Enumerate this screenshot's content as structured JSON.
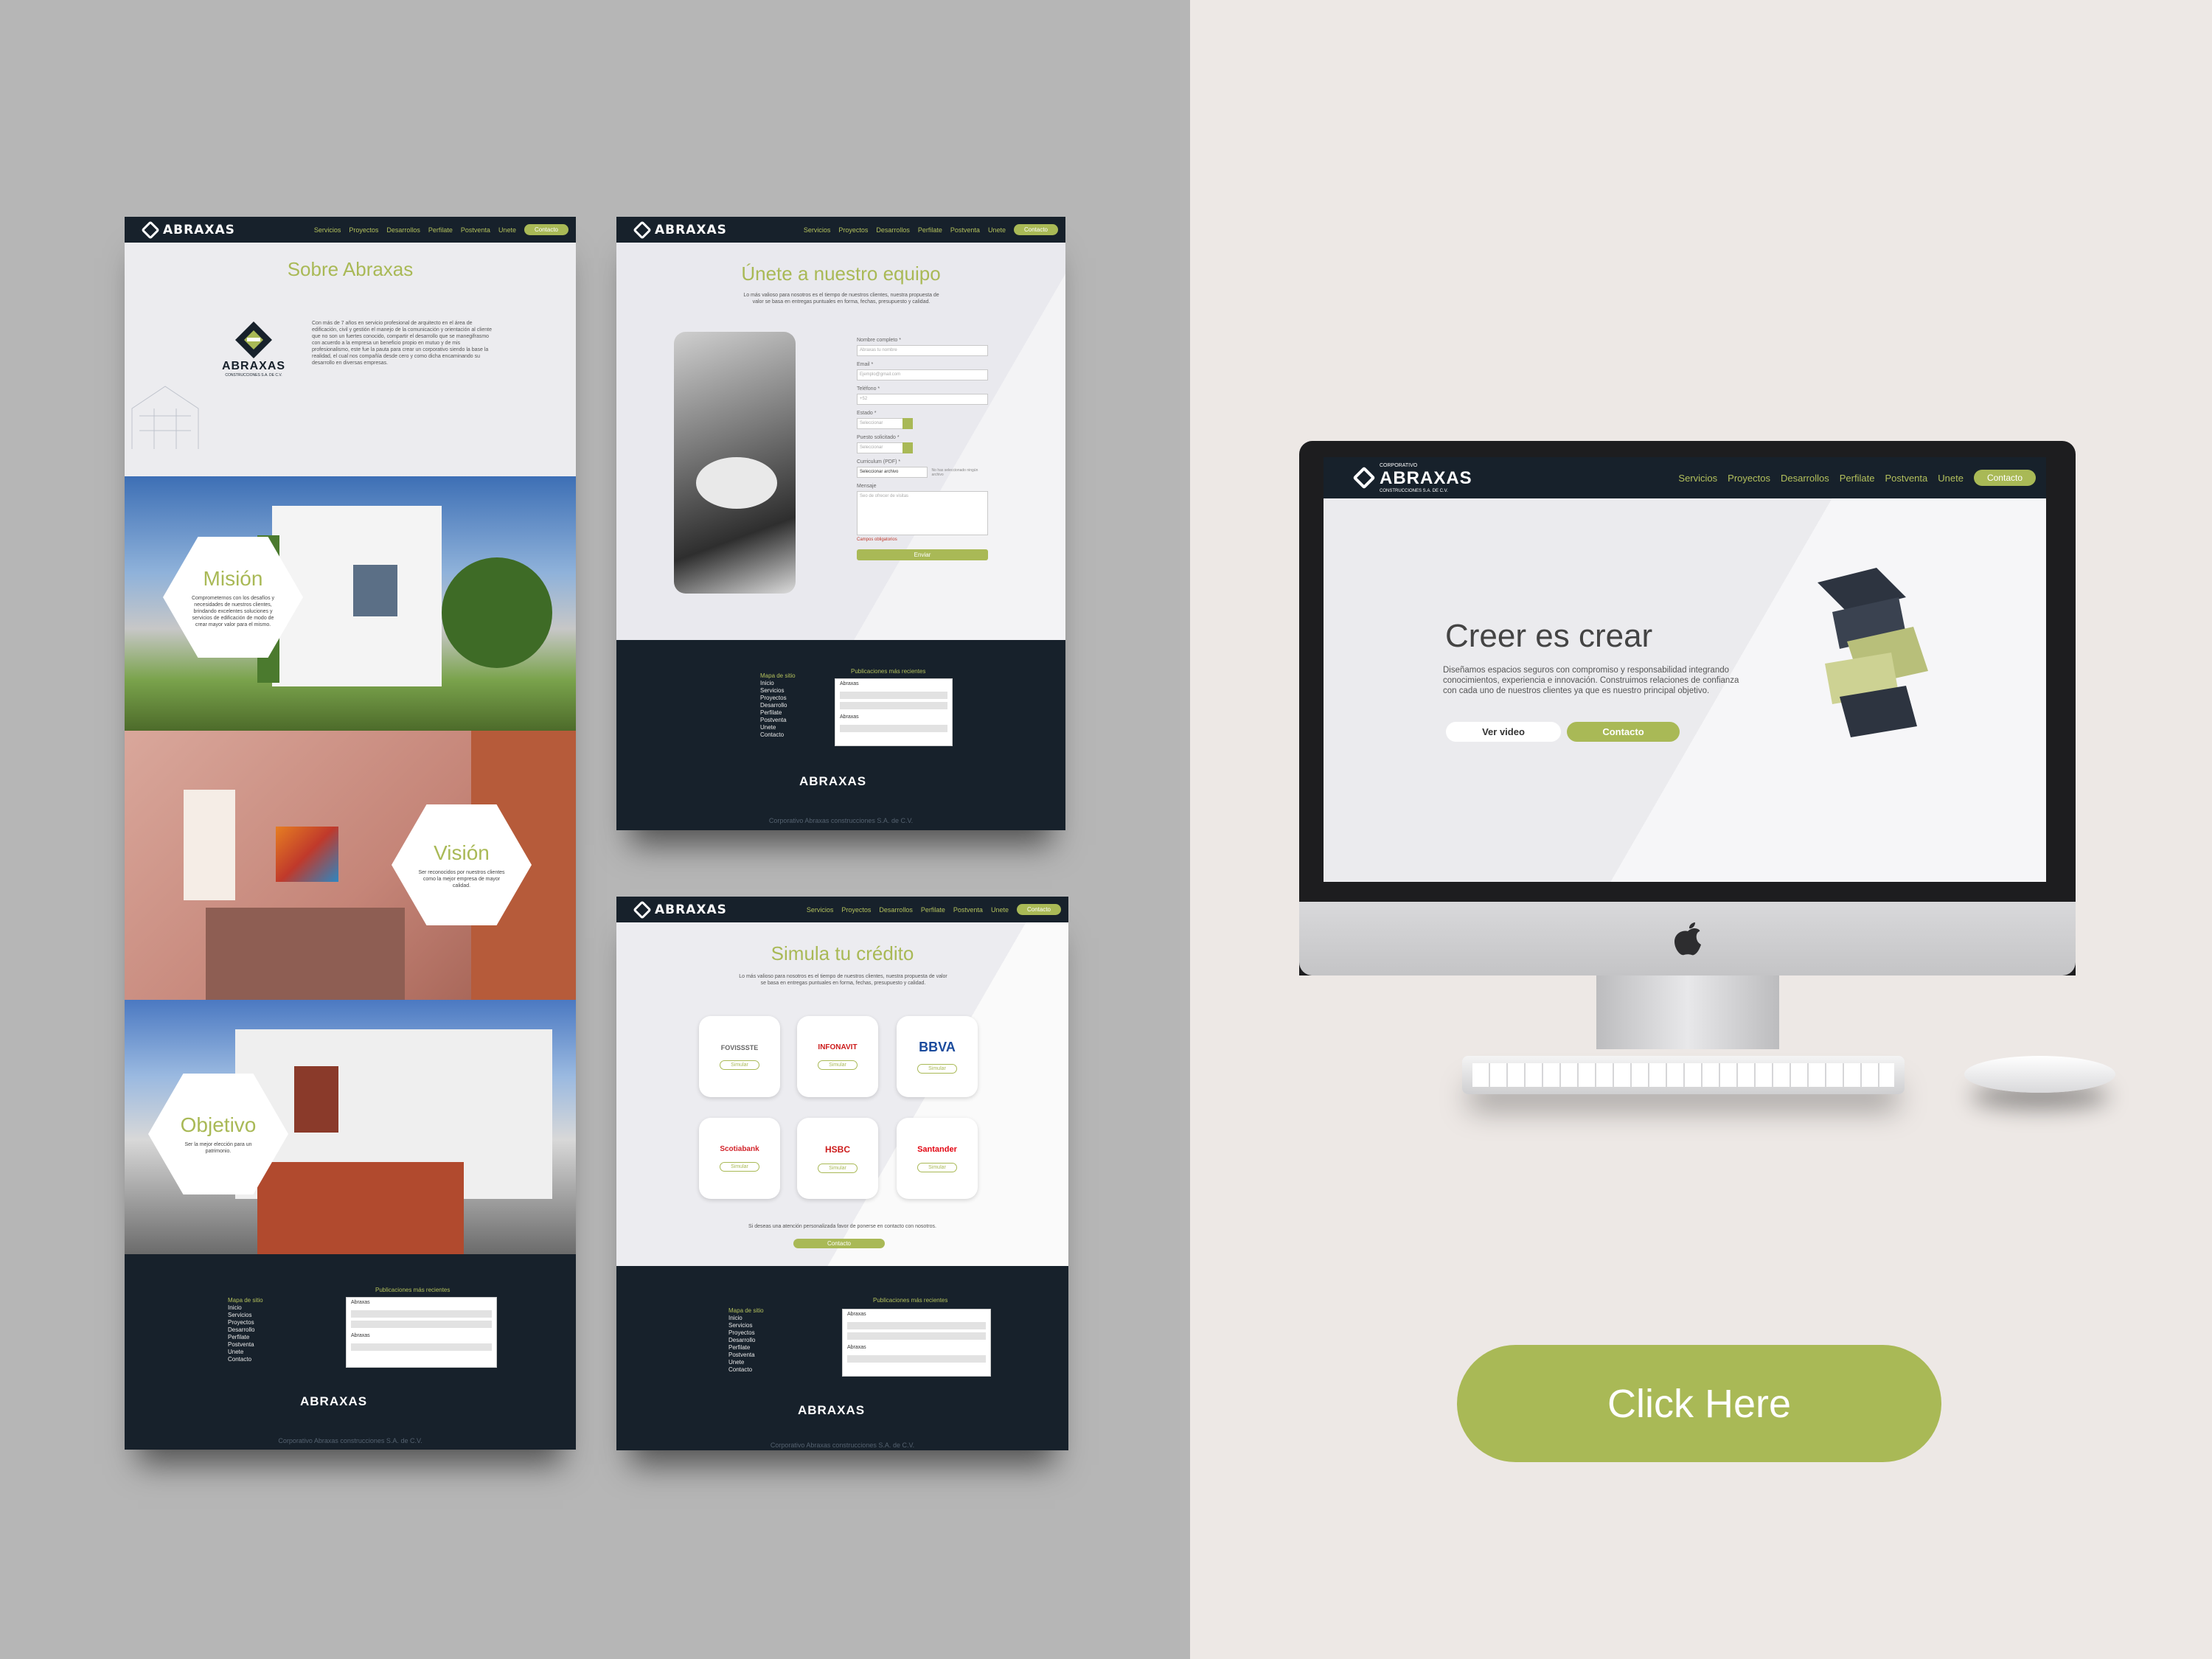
{
  "brand": {
    "name": "ABRAXAS",
    "corporate": "CORPORATIVO",
    "sub": "CONSTRUCCIONES S.A. DE C.V.",
    "accent": "#a9b956",
    "dark": "#17212b"
  },
  "nav": {
    "links": [
      "Servicios",
      "Proyectos",
      "Desarrollos",
      "Perfilate",
      "Postventa",
      "Unete"
    ],
    "contact": "Contacto"
  },
  "about": {
    "title": "Sobre Abraxas",
    "body": "Con más de 7 años en servicio profesional de arquitecto en el área de edificación, civil y gestión el manejo de la comunicación y orientación al cliente que no son un fuertes conocido, compartir el desarrollo que se manegifrasmo con acuerdo a la empresa un beneficio propio en mutuo y de mis profesionalismo, este fue la pauta para crear un corporativo siendo la base la realidad, el cual nos compañía desde cero y como dicha encaminando su desarrollo en diversas empresas."
  },
  "mission": {
    "title": "Misión",
    "text": "Comprometernos con los desafíos y necesidades de nuestros clientes, brindando excelentes soluciones y servicios de edificación de modo de crear mayor valor para el mismo."
  },
  "vision": {
    "title": "Visión",
    "text": "Ser reconocidos por nuestros clientes como la mejor empresa de mayor calidad."
  },
  "objective": {
    "title": "Objetivo",
    "text": "Ser la mejor elección para un patrimonio."
  },
  "join": {
    "title": "Únete a nuestro equipo",
    "intro": "Lo más valioso para nosotros es el tiempo de nuestros clientes, nuestra propuesta de valor se basa en entregas puntuales en forma, fechas, presupuesto y calidad.",
    "fields": [
      {
        "label": "Nombre completo *",
        "placeholder": "Abraxas tu nombre"
      },
      {
        "label": "Email *",
        "placeholder": "Ejemplo@gmail.com"
      },
      {
        "label": "Teléfono *",
        "placeholder": "+52"
      },
      {
        "label": "Estado *",
        "placeholder": "Seleccionar"
      },
      {
        "label": "Puesto solicitado *",
        "placeholder": "Seleccionar"
      },
      {
        "label": "Curriculum (PDF) *",
        "placeholder": "Seleccionar archivo"
      }
    ],
    "file_note": "No has seleccionado ningún archivo",
    "message_label": "Mensaje",
    "message_placeholder": "Seo de ofrecer de visitas",
    "required_note": "Campos obligatorios",
    "submit": "Enviar"
  },
  "footer": {
    "sitemap_title": "Mapa de sitio",
    "sitemap": [
      "Inicio",
      "Servicios",
      "Proyectos",
      "Desarrollo",
      "Perfilate",
      "Postventa",
      "Unete",
      "Contacto"
    ],
    "publications_title": "Publicaciones más recientes",
    "feed_names": [
      "Abraxas",
      "Abraxas"
    ],
    "copyright": "Corporativo Abraxas construcciones S.A. de C.V."
  },
  "credit": {
    "title": "Simula tu crédito",
    "intro": "Lo más valioso para nosotros es el tiempo de nuestros clientes, nuestra propuesta de valor se basa en entregas puntuales en forma, fechas, presupuesto y calidad.",
    "banks": [
      {
        "name": "FOVISSSTE",
        "color": "#666666"
      },
      {
        "name": "INFONAVIT",
        "color": "#cc1b1b"
      },
      {
        "name": "BBVA",
        "color": "#1a4a9c"
      },
      {
        "name": "Scotiabank",
        "color": "#d2232a"
      },
      {
        "name": "HSBC",
        "color": "#cc1b1b"
      },
      {
        "name": "Santander",
        "color": "#e30613"
      }
    ],
    "simulate": "Simular",
    "note": "Si deseas una atención personalizada favor de ponerse en contacto con nosotros.",
    "contact": "Contacto"
  },
  "hero": {
    "title": "Creer es crear",
    "text": "Diseñamos espacios seguros con compromiso y responsabilidad integrando conocimientos, experiencia e innovación. Construimos relaciones de confianza con cada uno de nuestros clientes ya que es nuestro principal objetivo.",
    "video": "Ver video",
    "contact": "Contacto"
  },
  "cta": {
    "label": "Click Here"
  },
  "icons": {
    "apple": "apple-logo-icon"
  }
}
